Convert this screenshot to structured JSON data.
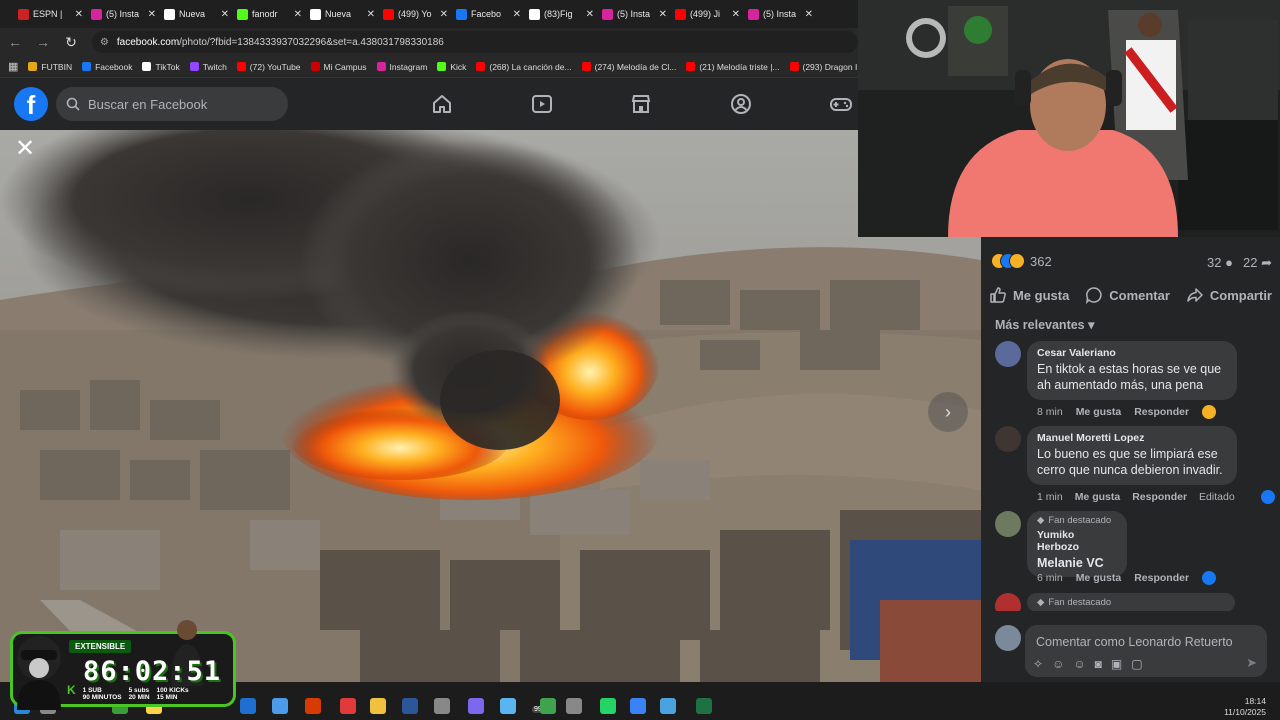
{
  "browser": {
    "tabs": [
      {
        "label": "ESPN |",
        "color": "#cc2222"
      },
      {
        "label": "(5) Insta",
        "color": "#d6249f"
      },
      {
        "label": "Nueva",
        "color": "#ffffff"
      },
      {
        "label": "fanodr",
        "color": "#53fc18"
      },
      {
        "label": "Nueva",
        "color": "#ffffff"
      },
      {
        "label": "(499) Yo",
        "color": "#ff0000"
      },
      {
        "label": "Facebo",
        "color": "#1877f2"
      },
      {
        "label": "(83)Fig",
        "color": "#ffffff"
      },
      {
        "label": "(5) Insta",
        "color": "#d6249f"
      },
      {
        "label": "(499) Ji",
        "color": "#ff0000"
      },
      {
        "label": "(5) Insta",
        "color": "#d6249f"
      }
    ],
    "url_host": "facebook.com",
    "url_path": "/photo/?fbid=1384333937032296&set=a.438031798330186",
    "bookmarks": [
      {
        "label": "FUTBIN",
        "color": "#e6a817"
      },
      {
        "label": "Facebook",
        "color": "#1877f2"
      },
      {
        "label": "TikTok",
        "color": "#ffffff"
      },
      {
        "label": "Twitch",
        "color": "#9146ff"
      },
      {
        "label": "(72) YouTube",
        "color": "#ff0000"
      },
      {
        "label": "Mi Campus",
        "color": "#cc0000"
      },
      {
        "label": "Instagram",
        "color": "#d6249f"
      },
      {
        "label": "Kick",
        "color": "#53fc18"
      },
      {
        "label": "(268) La canción de...",
        "color": "#ff0000"
      },
      {
        "label": "(274) Melodía de Cl...",
        "color": "#ff0000"
      },
      {
        "label": "(21) Melodía triste |...",
        "color": "#ff0000"
      },
      {
        "label": "(293) Dragon I",
        "color": "#ff0000"
      }
    ]
  },
  "facebook": {
    "logo": "f",
    "search_placeholder": "Buscar en Facebook",
    "nav_icons": [
      "home-icon",
      "video-icon",
      "marketplace-icon",
      "groups-icon",
      "gaming-icon"
    ]
  },
  "photo": {
    "close_glyph": "✕",
    "next_glyph": "›"
  },
  "post": {
    "reaction_count": "362",
    "comment_count": "32",
    "share_count": "22",
    "like_label": "Me gusta",
    "comment_label": "Comentar",
    "share_label": "Compartir",
    "sort_label": "Más relevantes",
    "composer_placeholder": "Comentar como Leonardo Retuerto"
  },
  "comments": [
    {
      "name": "Cesar Valeriano",
      "text": "En tiktok a estas horas se ve que ah aumentado más, una pena",
      "time": "8 min",
      "like": "Me gusta",
      "reply": "Responder",
      "extra": "",
      "fan": "",
      "reaction": "sad"
    },
    {
      "name": "Manuel Moretti Lopez",
      "text": "Lo bueno es que se limpiará ese cerro que nunca debieron invadir.",
      "time": "1 min",
      "like": "Me gusta",
      "reply": "Responder",
      "extra": "Editado",
      "fan": "",
      "reaction": "like"
    },
    {
      "name": "Yumiko Herbozo",
      "text": "Melanie VC",
      "time": "6 min",
      "like": "Me gusta",
      "reply": "Responder",
      "extra": "",
      "fan": "Fan destacado",
      "reaction": "like"
    },
    {
      "name": "",
      "text": "",
      "time": "",
      "like": "",
      "reply": "",
      "extra": "",
      "fan": "Fan destacado",
      "reaction": ""
    }
  ],
  "overlay": {
    "badge": "EXTENSIBLE",
    "timer": "86:02:51",
    "info": [
      {
        "top": "1 SUB",
        "bottom": "90 MINUTOS"
      },
      {
        "top": "5 subs",
        "bottom": "20 MIN"
      },
      {
        "top": "100 KICKs",
        "bottom": "15 MIN"
      }
    ]
  },
  "taskbar": {
    "time": "18:14",
    "date": "11/10/2025",
    "badge": "99+"
  },
  "colors": {
    "fb_blue": "#1877f2",
    "panel_bg": "#242526",
    "bubble_bg": "#3a3b3c",
    "timer_green": "#49c524"
  }
}
